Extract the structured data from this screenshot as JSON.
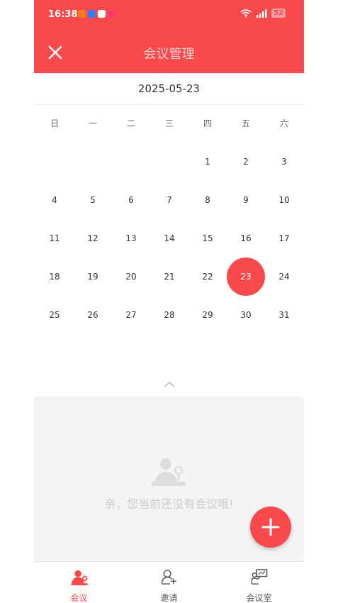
{
  "status_bar": {
    "time": "16:38",
    "battery": "52"
  },
  "header": {
    "title": "会议管理"
  },
  "calendar": {
    "selected_date": "2025-05-23",
    "weekdays": [
      "日",
      "一",
      "二",
      "三",
      "四",
      "五",
      "六"
    ],
    "weeks": [
      [
        "",
        "",
        "",
        "",
        "1",
        "2",
        "3"
      ],
      [
        "4",
        "5",
        "6",
        "7",
        "8",
        "9",
        "10"
      ],
      [
        "11",
        "12",
        "13",
        "14",
        "15",
        "16",
        "17"
      ],
      [
        "18",
        "19",
        "20",
        "21",
        "22",
        "23",
        "24"
      ],
      [
        "25",
        "26",
        "27",
        "28",
        "29",
        "30",
        "31"
      ]
    ],
    "selected_day": "23"
  },
  "empty_state": {
    "message": "亲，您当前还没有会议哦!"
  },
  "bottom_nav": [
    {
      "label": "会议",
      "icon": "meeting-person-icon"
    },
    {
      "label": "邀请",
      "icon": "invite-person-icon"
    },
    {
      "label": "会议室",
      "icon": "meeting-room-icon"
    }
  ],
  "colors": {
    "accent": "#f84a4c",
    "empty_bg": "#f4f4f4"
  }
}
